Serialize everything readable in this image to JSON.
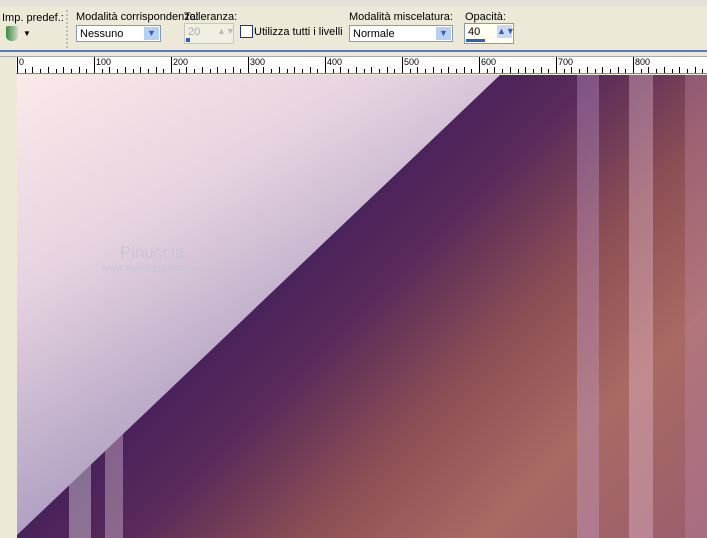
{
  "toolbar": {
    "preset_label": "Imp. predef.:",
    "match_mode_label": "Modalità corrispondenza:",
    "match_mode_value": "Nessuno",
    "tolerance_label": "Tolleranza:",
    "tolerance_value": "20",
    "use_all_layers_label": "Utilizza tutti i livelli",
    "use_all_layers_checked": false,
    "blend_mode_label": "Modalità miscelatura:",
    "blend_mode_value": "Normale",
    "opacity_label": "Opacità:",
    "opacity_value": "40",
    "opacity_fraction": 0.4
  },
  "ruler": {
    "labels": [
      "0",
      "100",
      "200",
      "300",
      "400",
      "500",
      "600",
      "700",
      "800"
    ]
  },
  "watermark": {
    "name": "Pinuccia",
    "url": "www.maidiregrafica.eu"
  }
}
